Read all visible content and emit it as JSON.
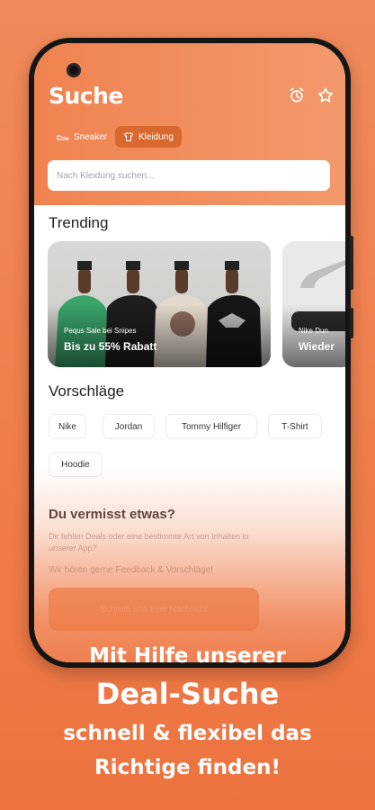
{
  "header": {
    "title": "Suche",
    "chips": [
      {
        "label": "Sneaker",
        "icon": "sneaker-icon",
        "active": false
      },
      {
        "label": "Kleidung",
        "icon": "shirt-icon",
        "active": true
      }
    ]
  },
  "search": {
    "placeholder": "Nach Kleidung suchen..."
  },
  "trending": {
    "title": "Trending",
    "cards": [
      {
        "subtitle": "Pequs Sale bei Snipes",
        "title": "Bis zu 55% Rabatt"
      },
      {
        "subtitle": "Nike Dun",
        "title": "Wieder"
      }
    ]
  },
  "suggestions": {
    "title": "Vorschläge",
    "tags": [
      "Nike",
      "Jordan",
      "Tommy Hilfiger",
      "T-Shirt",
      "Hoodie"
    ]
  },
  "feedback": {
    "title": "Du vermisst etwas?",
    "text": "Dir fehlen Deals oder eine bestimmte Art von Inhalten in unserer App?",
    "text2": "Wir hören gerne Feedback & Vorschläge!",
    "button": "Schreib uns eine Nachricht"
  },
  "caption": {
    "line1": "Mit Hilfe unserer",
    "line2": "Deal-Suche",
    "line3": "schnell & flexibel das",
    "line4": "Richtige finden!"
  },
  "colors": {
    "accent": "#ef7e4c",
    "chip_active": "#d9682e"
  }
}
